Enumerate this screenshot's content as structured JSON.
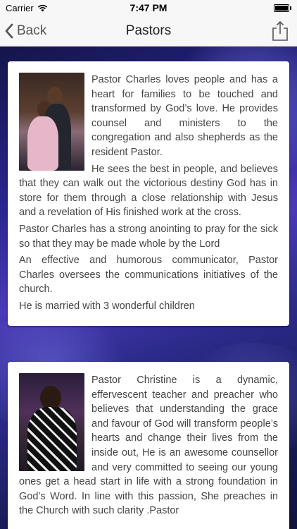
{
  "status_bar": {
    "carrier": "Carrier",
    "time": "7:47 PM"
  },
  "nav": {
    "back_label": "Back",
    "title": "Pastors"
  },
  "pastors": [
    {
      "paragraphs": [
        "Pastor Charles  loves people and has a heart for families to be touched and transformed by God’s love. He provides counsel and ministers to the congregation and also shepherds as the resident Pastor.",
        "He sees the best in people, and believes that they can walk out the victorious destiny God has in store for them through a close relationship with Jesus and a revelation of His finished work at the cross.",
        "Pastor Charles  has a strong anointing to pray for the sick so that they may be made whole by the Lord",
        "An effective and humorous communicator, Pastor Charles oversees the communications initiatives of the church.",
        "He is married with 3 wonderful children"
      ]
    },
    {
      "paragraphs": [
        "Pastor Christine is a  dynamic, effervescent teacher and preacher who believes that understanding the grace and favour of God will transform people’s hearts and change their lives from the inside out, He is an awesome counsellor and very committed to seeing our young ones get a head start in life with a strong foundation in God’s Word. In line with this passion, She  preaches in the  Church with such clarity .Pastor"
      ]
    }
  ]
}
